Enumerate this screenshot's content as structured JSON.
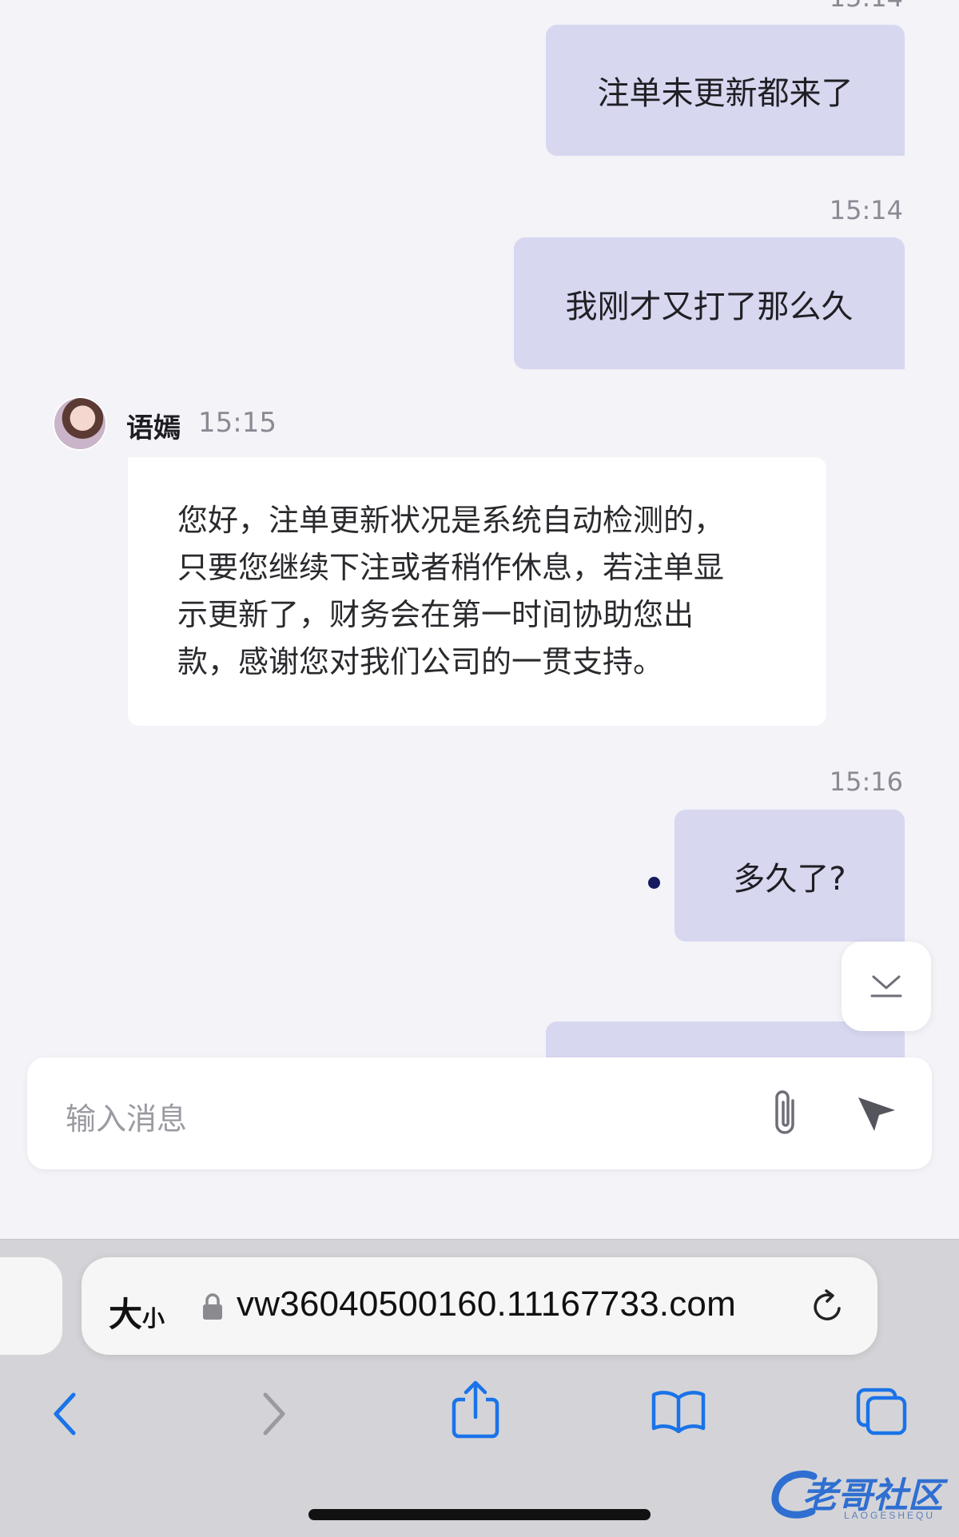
{
  "chat": {
    "messages": [
      {
        "direction": "out",
        "time": "15:14",
        "text": "注单未更新都来了"
      },
      {
        "direction": "out",
        "time": "15:14",
        "text": "我刚才又打了那么久"
      },
      {
        "direction": "in",
        "sender": "语嫣",
        "time": "15:15",
        "lines": [
          "您好，注单更新状况是系统自动检测的，",
          "只要您继续下注或者稍作休息，若注单显",
          "示更新了，财务会在第一时间协助您出",
          "款，感谢您对我们公司的一贯支持。"
        ]
      },
      {
        "direction": "out",
        "time": "15:16",
        "text": "多久了?",
        "unread": true
      }
    ]
  },
  "input": {
    "placeholder": "输入消息",
    "attach_icon": "paperclip-icon",
    "send_icon": "send-icon"
  },
  "browser": {
    "aa_label_big": "大",
    "aa_label_small": "小",
    "url": "vw36040500160.11167733.com",
    "lock_icon": "lock-icon",
    "reload_icon": "reload-icon",
    "toolbar_icons": [
      "back-icon",
      "forward-icon",
      "share-icon",
      "bookmarks-icon",
      "tabs-icon"
    ],
    "accent_color": "#1a73e8"
  },
  "watermark": {
    "text": "老哥社区",
    "subtext": "LAOGESHEQU"
  }
}
